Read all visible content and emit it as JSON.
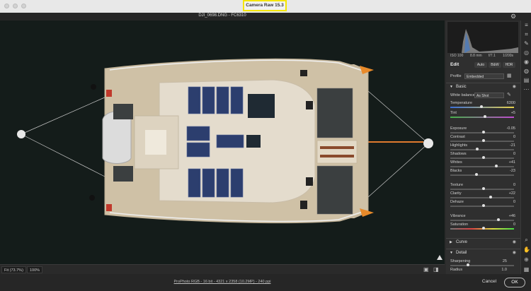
{
  "app": {
    "title": "Camera Raw 15.3"
  },
  "document": {
    "name": "DJI_0698.DNG  -  FC6310"
  },
  "histogram": {
    "exif": [
      "ISO 100",
      "8.8 mm",
      "f/7.1",
      "1/200s"
    ]
  },
  "edit": {
    "heading": "Edit",
    "buttons": [
      "Auto",
      "B&W",
      "HDR"
    ],
    "profile_label": "Profile",
    "profile_value": "Embedded"
  },
  "basic": {
    "title": "Basic",
    "white_balance_label": "White balance",
    "white_balance_value": "As Shot",
    "sliders": [
      {
        "label": "Temperature",
        "value": "6300",
        "pos": 0.47
      },
      {
        "label": "Tint",
        "value": "+5",
        "pos": 0.52
      },
      {
        "label": "Exposure",
        "value": "-0.05",
        "pos": 0.5
      },
      {
        "label": "Contrast",
        "value": "0",
        "pos": 0.5
      },
      {
        "label": "Highlights",
        "value": "-21",
        "pos": 0.4
      },
      {
        "label": "Shadows",
        "value": "0",
        "pos": 0.5
      },
      {
        "label": "Whites",
        "value": "+41",
        "pos": 0.7
      },
      {
        "label": "Blacks",
        "value": "-23",
        "pos": 0.39
      },
      {
        "label": "Texture",
        "value": "0",
        "pos": 0.5
      },
      {
        "label": "Clarity",
        "value": "+22",
        "pos": 0.61
      },
      {
        "label": "Dehaze",
        "value": "0",
        "pos": 0.5
      },
      {
        "label": "Vibrance",
        "value": "+46",
        "pos": 0.73
      },
      {
        "label": "Saturation",
        "value": "0",
        "pos": 0.5
      }
    ]
  },
  "curve": {
    "title": "Curve"
  },
  "detail": {
    "title": "Detail",
    "sharpening_label": "Sharpening",
    "sharpening_value": "25",
    "radius_label": "Radius",
    "radius_value": "1.0"
  },
  "canvas_bottom": {
    "fit": "Fit (73.7%)",
    "zoom": "100%"
  },
  "footer": {
    "workflow": "ProPhoto RGB - 16 bit - 4321 x 2358 (10.2MP) - 240 ppi",
    "cancel": "Cancel",
    "ok": "OK"
  },
  "colors": {
    "accent": "#f5e600",
    "panel": "#2f2f2f",
    "water": "#141c1a"
  }
}
